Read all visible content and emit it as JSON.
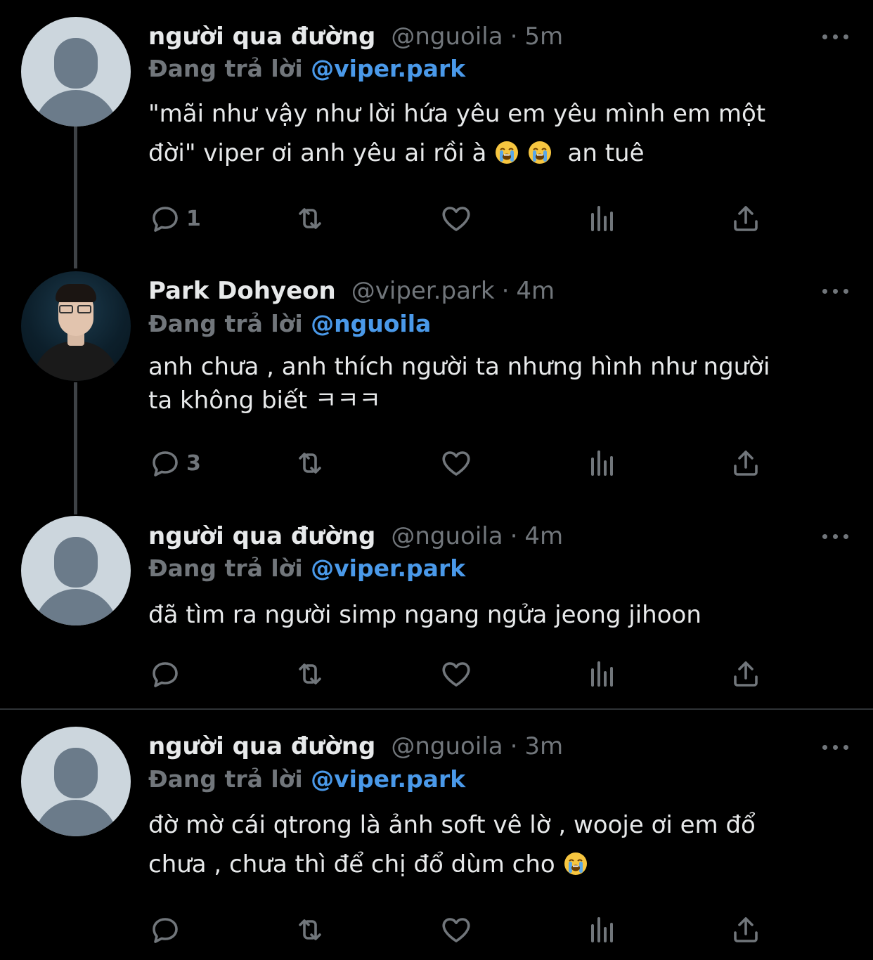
{
  "tweets": [
    {
      "name": "người qua đường",
      "handle": "@nguoila",
      "time": "5m",
      "reply_prefix": "Đang trả lời",
      "reply_mention": "@viper.park",
      "text_line1": "\"mãi như vậy như lời hứa yêu em yêu mình em một",
      "text_line2a": "đời\" viper ơi anh yêu ai rồi à",
      "text_line2b": "an tuê",
      "reply_count": "1",
      "avatar": "default-avatar"
    },
    {
      "name": "Park Dohyeon",
      "handle": "@viper.park",
      "time": "4m",
      "reply_prefix": "Đang trả lời",
      "reply_mention": "@nguoila",
      "text_line1": "anh chưa , anh thích người ta nhưng hình như người",
      "text_line2a": "ta không biết ㅋㅋㅋ",
      "reply_count": "3",
      "avatar": "profile-photo"
    },
    {
      "name": "người qua đường",
      "handle": "@nguoila",
      "time": "4m",
      "reply_prefix": "Đang trả lời",
      "reply_mention": "@viper.park",
      "text_line1": "đã tìm ra người simp ngang ngửa jeong jihoon",
      "reply_count": "",
      "avatar": "default-avatar"
    },
    {
      "name": "người qua đường",
      "handle": "@nguoila",
      "time": "3m",
      "reply_prefix": "Đang trả lời",
      "reply_mention": "@viper.park",
      "text_line1": "đờ mờ cái qtrong là ảnh soft vê lờ , wooje ơi em đổ",
      "text_line2a": "chưa , chưa thì để chị đổ dùm cho",
      "reply_count": "",
      "avatar": "default-avatar"
    }
  ],
  "separator": "·",
  "icons": [
    "reply-icon",
    "retweet-icon",
    "like-icon",
    "views-icon",
    "share-icon",
    "more-icon",
    "crying-face-emoji"
  ],
  "colors": {
    "background": "#000000",
    "primary_text": "#e7e9ea",
    "secondary_text": "#71767b",
    "mention": "#4a99e9",
    "thread_line": "#3e4246"
  }
}
